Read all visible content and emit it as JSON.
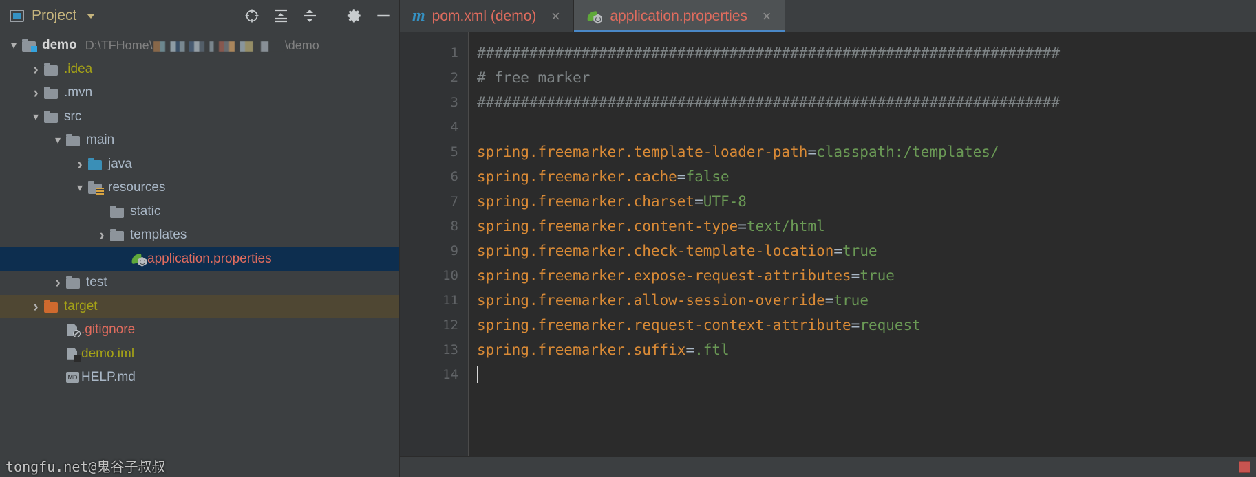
{
  "toolwindow": {
    "title": "Project",
    "icons": {
      "project": "project-window-icon",
      "dropdown": "chevron-down-icon",
      "locate": "locate-file-icon",
      "expand_all": "expand-all-icon",
      "collapse_all": "collapse-all-icon",
      "settings": "gear-icon",
      "hide": "minimize-icon"
    }
  },
  "tree": [
    {
      "label": "demo",
      "path": "D:\\TFHome\\",
      "path_suffix": "\\demo",
      "icon": "module-folder-icon",
      "arrow": "open",
      "indent": 0,
      "style": "bold",
      "blurred_path": true
    },
    {
      "label": ".idea",
      "icon": "folder-icon",
      "arrow": "closed",
      "indent": 1,
      "style": "olive"
    },
    {
      "label": ".mvn",
      "icon": "folder-icon",
      "arrow": "closed",
      "indent": 1,
      "style": "normal"
    },
    {
      "label": "src",
      "icon": "folder-icon",
      "arrow": "open",
      "indent": 1,
      "style": "normal"
    },
    {
      "label": "main",
      "icon": "folder-icon",
      "arrow": "open",
      "indent": 2,
      "style": "normal"
    },
    {
      "label": "java",
      "icon": "source-root-folder-icon",
      "arrow": "closed",
      "indent": 3,
      "style": "normal"
    },
    {
      "label": "resources",
      "icon": "resource-root-folder-icon",
      "arrow": "open",
      "indent": 3,
      "style": "normal"
    },
    {
      "label": "static",
      "icon": "folder-icon",
      "arrow": "none",
      "indent": 4,
      "style": "normal"
    },
    {
      "label": "templates",
      "icon": "folder-icon",
      "arrow": "closed",
      "indent": 4,
      "style": "normal"
    },
    {
      "label": "application.properties",
      "icon": "spring-boot-icon",
      "arrow": "none",
      "indent": 5,
      "style": "salmon",
      "selected": true
    },
    {
      "label": "test",
      "icon": "folder-icon",
      "arrow": "closed",
      "indent": 2,
      "style": "normal"
    },
    {
      "label": "target",
      "icon": "excluded-folder-icon",
      "arrow": "closed",
      "indent": 1,
      "style": "olive",
      "highlighted": true
    },
    {
      "label": ".gitignore",
      "icon": "ignored-file-icon",
      "arrow": "none",
      "indent": 2,
      "style": "salmon"
    },
    {
      "label": "demo.iml",
      "icon": "iml-file-icon",
      "arrow": "none",
      "indent": 2,
      "style": "olive"
    },
    {
      "label": "HELP.md",
      "icon": "markdown-file-icon",
      "arrow": "none",
      "indent": 2,
      "style": "normal"
    }
  ],
  "watermark": "tongfu.net@鬼谷子叔叔",
  "tabs": [
    {
      "label": "pom.xml (demo)",
      "icon": "maven-icon",
      "active": false,
      "close": "×"
    },
    {
      "label": "application.properties",
      "icon": "spring-boot-icon",
      "active": true,
      "close": "×"
    }
  ],
  "editor": {
    "line_numbers": [
      "1",
      "2",
      "3",
      "4",
      "5",
      "6",
      "7",
      "8",
      "9",
      "10",
      "11",
      "12",
      "13",
      "14"
    ],
    "lines": [
      {
        "type": "comment",
        "text": "###################################################################"
      },
      {
        "type": "comment",
        "text": "# free marker"
      },
      {
        "type": "comment",
        "text": "###################################################################"
      },
      {
        "type": "blank",
        "text": ""
      },
      {
        "type": "prop",
        "key": "spring.freemarker.template-loader-path",
        "eq": "=",
        "value": "classpath:/templates/"
      },
      {
        "type": "prop",
        "key": "spring.freemarker.cache",
        "eq": "=",
        "value": "false"
      },
      {
        "type": "prop",
        "key": "spring.freemarker.charset",
        "eq": "=",
        "value": "UTF-8"
      },
      {
        "type": "prop",
        "key": "spring.freemarker.content-type",
        "eq": "=",
        "value": "text/html"
      },
      {
        "type": "prop",
        "key": "spring.freemarker.check-template-location",
        "eq": "=",
        "value": "true"
      },
      {
        "type": "prop",
        "key": "spring.freemarker.expose-request-attributes",
        "eq": "=",
        "value": "true"
      },
      {
        "type": "prop",
        "key": "spring.freemarker.allow-session-override",
        "eq": "=",
        "value": "true"
      },
      {
        "type": "prop",
        "key": "spring.freemarker.request-context-attribute",
        "eq": "=",
        "value": "request"
      },
      {
        "type": "prop",
        "key": "spring.freemarker.suffix",
        "eq": "=",
        "value": ".ftl"
      },
      {
        "type": "caret",
        "text": ""
      }
    ]
  },
  "colors": {
    "panel_bg": "#3c3f41",
    "editor_bg": "#2b2b2b",
    "gutter_bg": "#313335",
    "selection_bg": "#0d2e4f",
    "excluded_bg": "#4f4733",
    "tab_text": "#e06c5e",
    "active_tab_underline": "#4a88c7",
    "key_color": "#d98a36",
    "value_color": "#6a9955",
    "comment_color": "#7e8486",
    "olive_text": "#a5a217"
  }
}
